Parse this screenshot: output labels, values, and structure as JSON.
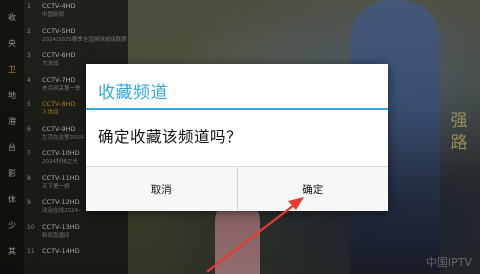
{
  "categories": [
    {
      "label": "收",
      "selected": false
    },
    {
      "label": "央",
      "selected": false
    },
    {
      "label": "卫",
      "selected": true
    },
    {
      "label": "地",
      "selected": false
    },
    {
      "label": "港",
      "selected": false
    },
    {
      "label": "台",
      "selected": false
    },
    {
      "label": "影",
      "selected": false
    },
    {
      "label": "体",
      "selected": false
    },
    {
      "label": "少",
      "selected": false
    },
    {
      "label": "其",
      "selected": false
    }
  ],
  "channels": [
    {
      "num": "1",
      "name": "CCTV-4HD",
      "program": "中国新闻",
      "selected": false
    },
    {
      "num": "2",
      "name": "CCTV-5HD",
      "program": "2024/2025赛季全国排球超级联赛",
      "selected": false
    },
    {
      "num": "3",
      "name": "CCTV-6HD",
      "program": "大决战",
      "selected": false
    },
    {
      "num": "4",
      "name": "CCTV-7HD",
      "program": "老兵风采第一季",
      "selected": false
    },
    {
      "num": "5",
      "name": "CCTV-8HD",
      "program": "人世间",
      "selected": true
    },
    {
      "num": "6",
      "name": "CCTV-9HD",
      "program": "生活在这里2024-",
      "selected": false
    },
    {
      "num": "7",
      "name": "CCTV-10HD",
      "program": "2024科技之光",
      "selected": false
    },
    {
      "num": "8",
      "name": "CCTV-11HD",
      "program": "天下第一桥",
      "selected": false
    },
    {
      "num": "9",
      "name": "CCTV-12HD",
      "program": "法治在线2024-",
      "selected": false
    },
    {
      "num": "10",
      "name": "CCTV-13HD",
      "program": "新闻直播间",
      "selected": false
    },
    {
      "num": "11",
      "name": "CCTV-14HD",
      "program": "",
      "selected": false
    }
  ],
  "dialog": {
    "title": "收藏频道",
    "message": "确定收藏该频道吗？",
    "cancel_label": "取消",
    "confirm_label": "确定"
  },
  "overlay": {
    "vertical_logo": "强\n路",
    "watermark": "中国IPTV"
  },
  "colors": {
    "accent": "#33a8e0",
    "selected_channel": "#e8a23a",
    "arrow": "#e8392f"
  }
}
